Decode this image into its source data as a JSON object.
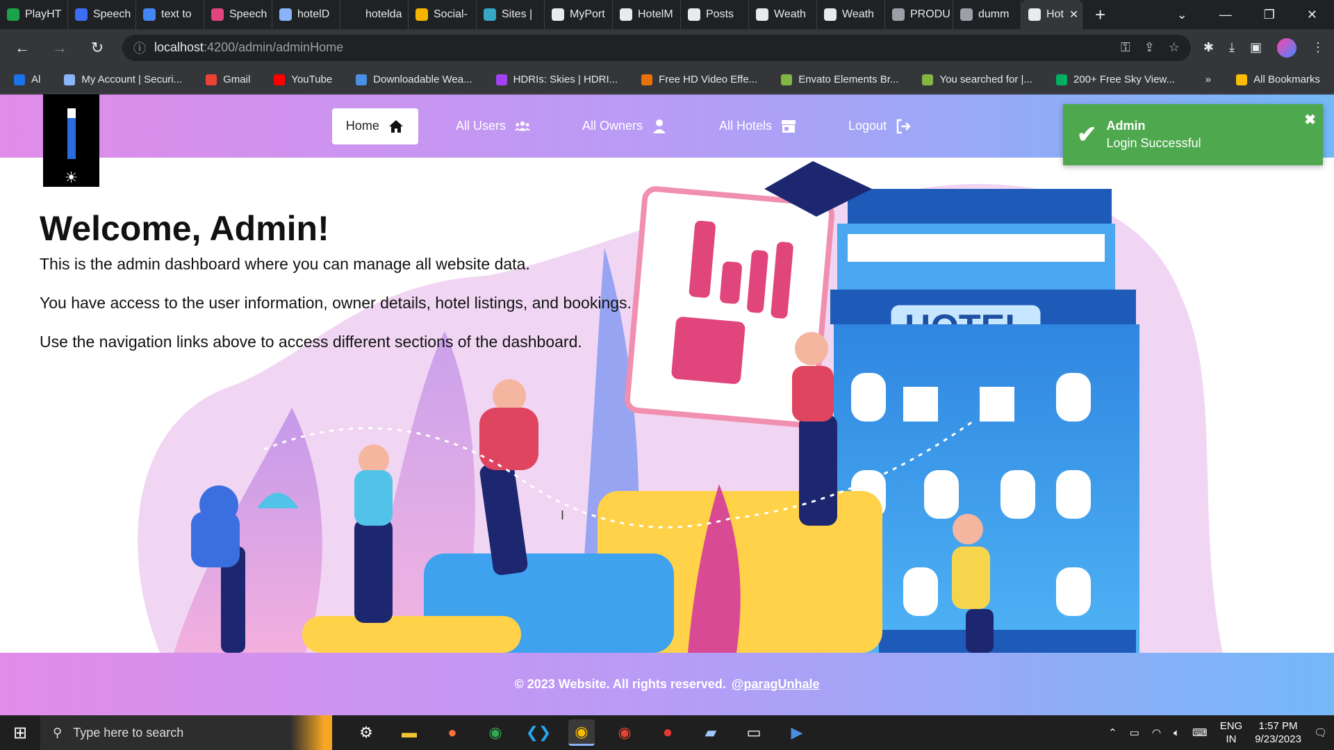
{
  "browser": {
    "tabs": [
      {
        "label": "PlayHT",
        "color": "#1aa34a"
      },
      {
        "label": "Speech",
        "color": "#3b6ef5"
      },
      {
        "label": "text to",
        "color": "#4285f4"
      },
      {
        "label": "Speech",
        "color": "#e0457b"
      },
      {
        "label": "hotelD",
        "color": "#8ab4f8"
      },
      {
        "label": "hotelda",
        "color": "#202124"
      },
      {
        "label": "Social-",
        "color": "#f4b400"
      },
      {
        "label": "Sites | ",
        "color": "#34a8c4"
      },
      {
        "label": "MyPort",
        "color": "#e8eaed"
      },
      {
        "label": "HotelM",
        "color": "#e8eaed"
      },
      {
        "label": "Posts",
        "color": "#e8eaed"
      },
      {
        "label": "Weath",
        "color": "#e8eaed"
      },
      {
        "label": "Weath",
        "color": "#e8eaed"
      },
      {
        "label": "PRODU",
        "color": "#9aa0a6"
      },
      {
        "label": "dumm",
        "color": "#9aa0a6"
      }
    ],
    "active_tab": "Hot",
    "url_host": "localhost",
    "url_path": ":4200/admin/adminHome",
    "bookmarks": [
      {
        "label": "Al",
        "color": "#1a73e8"
      },
      {
        "label": "My Account | Securi...",
        "color": "#8ab4f8"
      },
      {
        "label": "Gmail",
        "color": "#ea4335"
      },
      {
        "label": "YouTube",
        "color": "#ff0000"
      },
      {
        "label": "Downloadable Wea...",
        "color": "#4a90e2"
      },
      {
        "label": "HDRIs: Skies | HDRI...",
        "color": "#a142f4"
      },
      {
        "label": "Free HD Video Effe...",
        "color": "#e8710a"
      },
      {
        "label": "Envato Elements Br...",
        "color": "#82b541"
      },
      {
        "label": "You searched for |...",
        "color": "#82b541"
      },
      {
        "label": "200+ Free Sky View...",
        "color": "#02ae5f"
      }
    ],
    "all_bookmarks": "All Bookmarks"
  },
  "nav": {
    "home": "Home",
    "users": "All Users",
    "owners": "All Owners",
    "hotels": "All Hotels",
    "logout": "Logout"
  },
  "toast": {
    "title": "Admin",
    "message": "Login Successful"
  },
  "welcome": {
    "heading": "Welcome, Admin!",
    "line1": "This is the admin dashboard where you can manage all website data.",
    "line2": "You have access to the user information, owner details, hotel listings, and bookings.",
    "line3": "Use the navigation links above to access different sections of the dashboard."
  },
  "hero_sign": "HOTEL",
  "footer": {
    "copyright": "© 2023 Website. All rights reserved.",
    "handle": "@paragUnhale"
  },
  "taskbar": {
    "search_placeholder": "Type here to search",
    "lang1": "ENG",
    "lang2": "IN",
    "time": "1:57 PM",
    "date": "9/23/2023"
  }
}
